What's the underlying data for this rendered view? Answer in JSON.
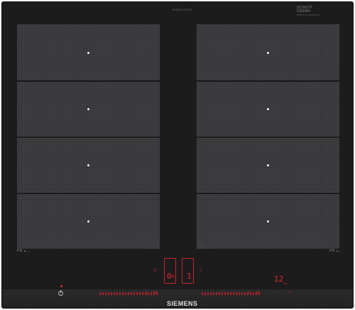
{
  "cooktop": {
    "top_marking": "EH875LFE1E",
    "schott_ceran": [
      "SCHOTT",
      "CERAN"
    ],
    "schott_small": "MADE IN GERMANY",
    "brand": "SIEMENS",
    "zone_label_left": "FN  ⩓↔",
    "zone_label_right": "FN  ⩓↔"
  },
  "controls": {
    "display_left_timer": "0",
    "display_left_sub": "8",
    "display_right_sub": "1",
    "left_small_indicator": "8",
    "right_small_indicator": "0",
    "power_level": "12",
    "power_level_sub": "min",
    "markers": [
      "C",
      "W",
      "—",
      "E",
      "W"
    ],
    "bottom_left_marks": [
      "→",
      "⁞"
    ],
    "bottom_right_marks": [
      "⌂",
      "⌂",
      "⏻"
    ]
  },
  "colors": {
    "glass": "#1c1c1d",
    "zone_fill": "#3d3d3f",
    "led_red": "#e0262e",
    "logo": "#dedede"
  }
}
